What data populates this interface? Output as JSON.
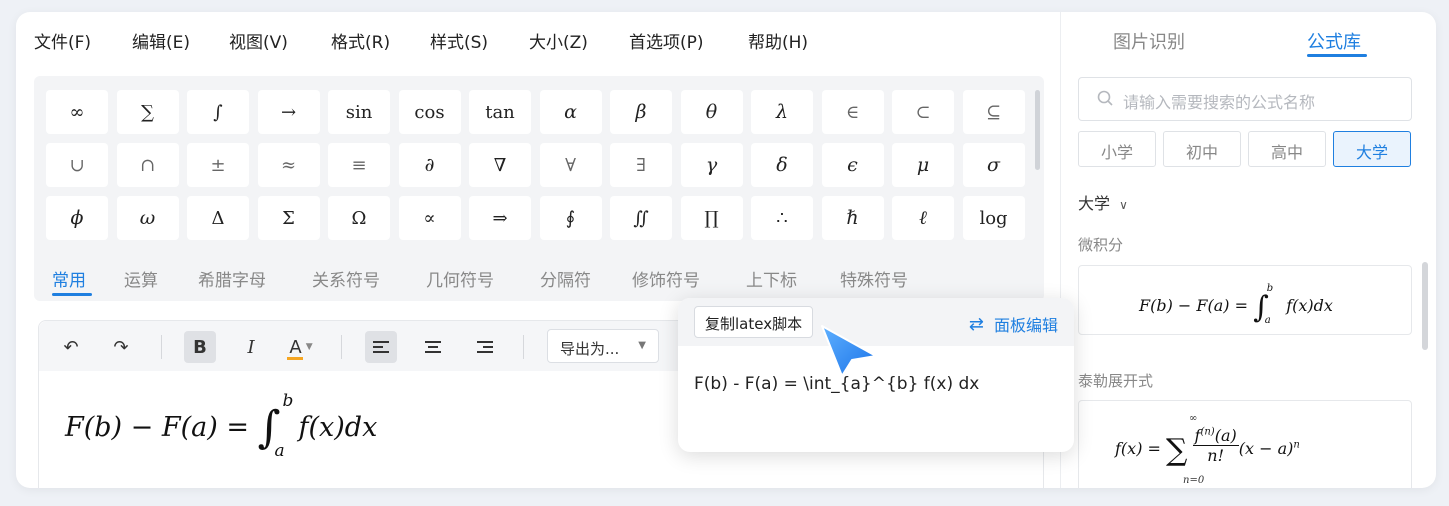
{
  "menu": [
    "文件(F)",
    "编辑(E)",
    "视图(V)",
    "格式(R)",
    "样式(S)",
    "大小(Z)",
    "首选项(P)",
    "帮助(H)"
  ],
  "symbols": [
    [
      "∞",
      "∑",
      "∫",
      "→",
      "sin",
      "cos",
      "tan",
      "α",
      "β",
      "θ",
      "λ",
      "∈",
      "⊂",
      "⊆"
    ],
    [
      "∪",
      "∩",
      "±",
      "≈",
      "≡",
      "∂",
      "∇",
      "∀",
      "∃",
      "γ",
      "δ",
      "ϵ",
      "μ",
      "σ"
    ],
    [
      "ϕ",
      "ω",
      "Δ",
      "Σ",
      "Ω",
      "∝",
      "⇒",
      "∮",
      "∬",
      "∏",
      "∴",
      "ℏ",
      "ℓ",
      "log"
    ]
  ],
  "symbol_tabs": [
    "常用",
    "运算",
    "希腊字母",
    "关系符号",
    "几何符号",
    "分隔符",
    "修饰符号",
    "上下标",
    "特殊符号"
  ],
  "active_symbol_tab": "常用",
  "toolbar": {
    "undo_icon": "↶",
    "redo_icon": "↷",
    "bold": "B",
    "italic": "I",
    "color_label": "A",
    "export_label": "导出为...",
    "accent_color": "#f5a623"
  },
  "editor": {
    "lhs": "F(b) − F(a) = ",
    "int_symbol": "∫",
    "upper": "b",
    "lower": "a",
    "integrand": "f(x)dx"
  },
  "popup": {
    "copy_button": "复制latex脚本",
    "panel_edit": "面板编辑",
    "latex": "F(b) - F(a) = \\int_{a}^{b} f(x) dx"
  },
  "right_tabs": [
    "图片识别",
    "公式库"
  ],
  "active_right_tab": "公式库",
  "search_placeholder": "请输入需要搜索的公式名称",
  "levels": [
    "小学",
    "初中",
    "高中",
    "大学"
  ],
  "active_level": "大学",
  "level_dropdown": "大学",
  "sections": [
    {
      "label": "微积分",
      "formula": "F(b) − F(a) = ∫ab f(x)dx"
    },
    {
      "label": "泰勒展开式",
      "formula": "f(x) = ∑ f(n)(a)/n! (x − a)n"
    }
  ],
  "colors": {
    "accent": "#1f7fe0",
    "panel_bg": "#f3f4f6"
  }
}
